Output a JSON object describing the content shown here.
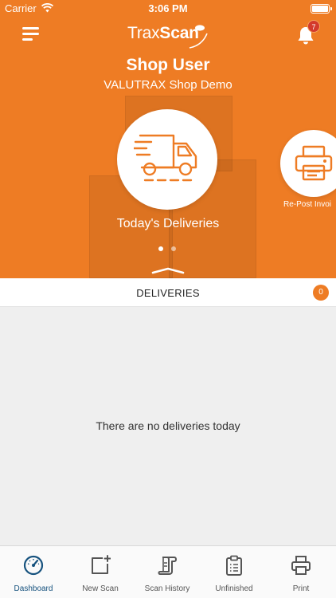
{
  "status_bar": {
    "carrier": "Carrier",
    "time": "3:06 PM"
  },
  "header": {
    "brand_light": "Trax",
    "brand_bold": "Scan",
    "notification_count": "7"
  },
  "profile": {
    "user_name": "Shop User",
    "shop_name": "VALUTRAX Shop Demo"
  },
  "carousel": {
    "items": [
      {
        "label": "Today's Deliveries",
        "icon": "delivery-truck-icon"
      },
      {
        "label": "Re-Post Invoi",
        "icon": "printer-icon"
      }
    ],
    "page_count": 2,
    "active_page": 0
  },
  "deliveries": {
    "title": "DELIVERIES",
    "count": "0",
    "empty_message": "There are no deliveries today"
  },
  "tab_bar": {
    "tabs": [
      {
        "label": "Dashboard",
        "icon": "dashboard-gauge-icon"
      },
      {
        "label": "New Scan",
        "icon": "new-scan-icon"
      },
      {
        "label": "Scan History",
        "icon": "scan-history-icon"
      },
      {
        "label": "Unfinished",
        "icon": "clipboard-icon"
      },
      {
        "label": "Print",
        "icon": "printer-icon"
      }
    ],
    "active_tab": "Dashboard"
  },
  "colors": {
    "brand_orange": "#ee7c24",
    "active_tab_blue": "#16527e",
    "badge_red": "#d33a2c",
    "background_grey": "#efefef"
  }
}
